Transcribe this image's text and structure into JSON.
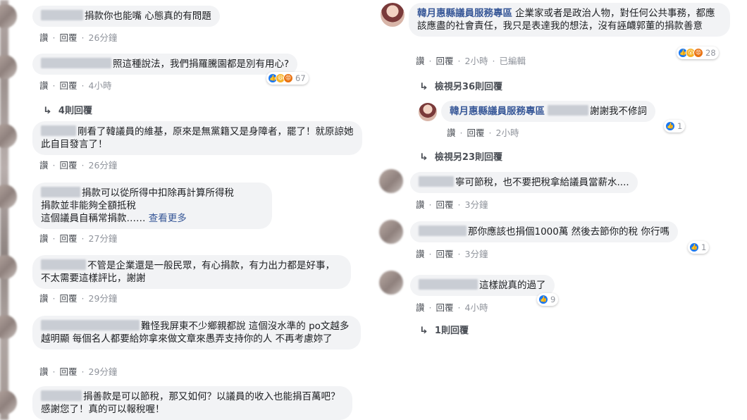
{
  "left_comments": [
    {
      "text": "捐款你也能嘴 心態真的有問題",
      "actions": [
        "讚",
        "回覆"
      ],
      "time": "26分鐘"
    },
    {
      "text": "照這種說法，我們捐羅騰園都是別有用心?",
      "actions": [
        "讚",
        "回覆"
      ],
      "time": "4小時",
      "reaction_count": "67",
      "reply_link": "4則回覆"
    },
    {
      "text": "剛看了韓議員的維基，原來是無黨籍又是身障者，罷了！就原諒她此自目發言了！",
      "actions": [
        "讚",
        "回覆"
      ],
      "time": "26分鐘"
    },
    {
      "text_lines": [
        "捐款可以從所得中扣除再計算所得稅",
        "捐款並非能夠全額抵稅",
        "這個議員自稱常捐款……"
      ],
      "see_more": "查看更多",
      "actions": [
        "讚",
        "回覆"
      ],
      "time": "27分鐘"
    },
    {
      "text": "不管是企業還是一般民眾，有心捐款，有力出力都是好事，不太需要這樣評比，謝謝",
      "actions": [
        "讚",
        "回覆"
      ],
      "time": "29分鐘"
    },
    {
      "text": "難怪我屏東不少鄉親都說 這個沒水準的 po文越多 越明顯 每個名人都要給妳拿來做文章來愚弄支持你的人 不再考慮妳了",
      "actions": [
        "讚",
        "回覆"
      ],
      "time": "29分鐘"
    },
    {
      "text": "捐善款是可以節稅，那又如何？以議員的收入也能捐百萬吧？感謝您了！真的可以報稅喔！"
    }
  ],
  "right_comments": [
    {
      "page_name": "韓月惠縣議員服務專區",
      "text": "企業家或者是政治人物，對任何公共事務，都應該應盡的社會責任，我只是表達我的想法，沒有誣衊郭董的捐款善意",
      "actions": [
        "讚",
        "回覆"
      ],
      "time": "2小時",
      "edited": "已編輯",
      "reaction_count": "28",
      "reply_link": "檢視另36則回覆"
    },
    {
      "page_name": "韓月惠縣議員服務專區",
      "text": "謝謝我不修詞",
      "actions": [
        "讚",
        "回覆"
      ],
      "time": "2小時",
      "reaction_count": "1",
      "reply_link": "檢視另23則回覆"
    },
    {
      "text": "寧可節稅，也不要把稅拿給議員當薪水....",
      "actions": [
        "讚",
        "回覆"
      ],
      "time": "3分鐘"
    },
    {
      "text": "那你應該也捐個1000萬 然後去節你的稅 你行嗎",
      "actions": [
        "讚",
        "回覆"
      ],
      "time": "3分鐘",
      "reaction_count": "1"
    },
    {
      "text": "這樣說真的過了",
      "actions": [
        "讚",
        "回覆"
      ],
      "time": "4小時",
      "reaction_count": "9",
      "reply_link": "1則回覆"
    }
  ],
  "colors": {
    "bubble": "#f2f3f5",
    "link": "#385898",
    "like": "#1877f2"
  }
}
